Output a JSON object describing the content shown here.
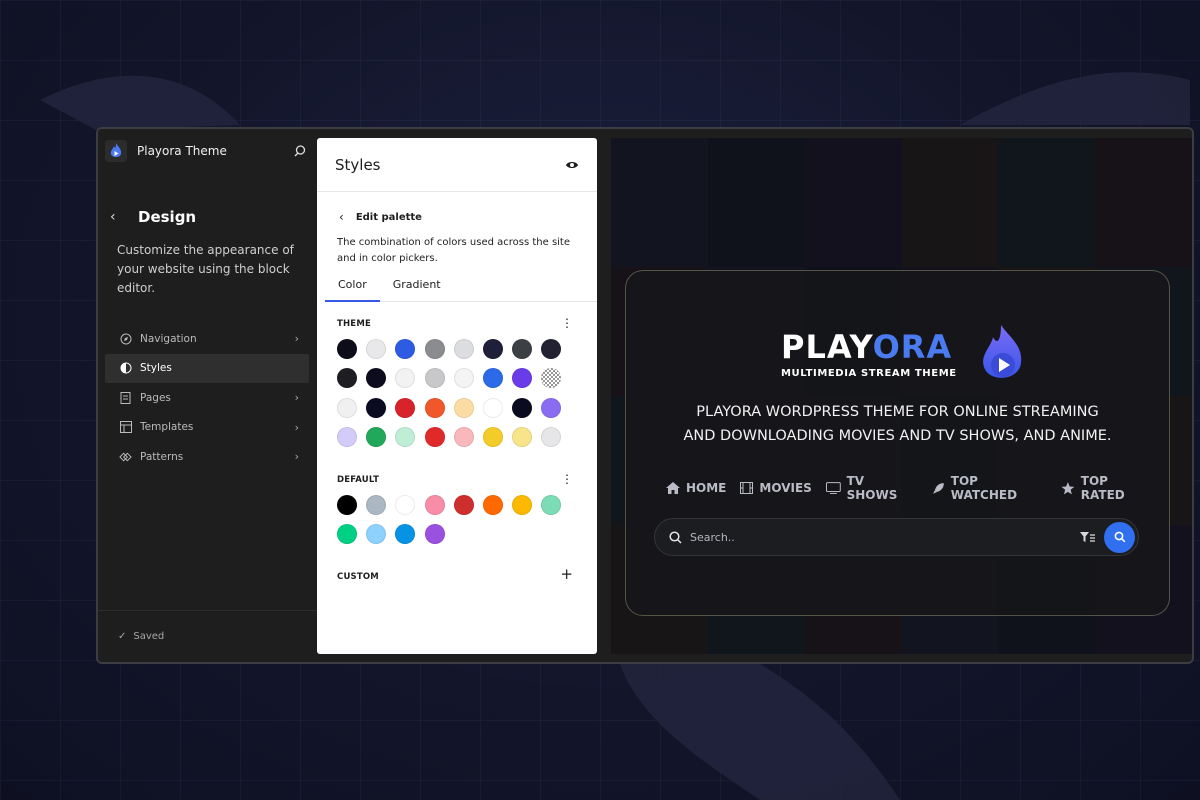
{
  "sidebar": {
    "site_title": "Playora Theme",
    "heading": "Design",
    "description": "Customize the appearance of your website using the block editor.",
    "items": [
      {
        "label": "Navigation",
        "icon": "compass-icon",
        "active": false
      },
      {
        "label": "Styles",
        "icon": "half-circle-icon",
        "active": true
      },
      {
        "label": "Pages",
        "icon": "page-icon",
        "active": false
      },
      {
        "label": "Templates",
        "icon": "layout-icon",
        "active": false
      },
      {
        "label": "Patterns",
        "icon": "diamond-icon",
        "active": false
      }
    ],
    "status": "Saved"
  },
  "styles_panel": {
    "title": "Styles",
    "subheading": "Edit palette",
    "description": "The combination of colors used across the site and in color pickers.",
    "tabs": [
      {
        "label": "Color",
        "active": true
      },
      {
        "label": "Gradient",
        "active": false
      }
    ],
    "theme_label": "THEME",
    "theme_colors": [
      "#0d0d1a",
      "#e8e8ea",
      "#2d5be3",
      "#8a8c90",
      "#dcdde0",
      "#1f1f3a",
      "#3c3f44",
      "#222233",
      "#1e1e22",
      "#0c0c1e",
      "#f2f2f3",
      "#c8c8ca",
      "#f4f4f5",
      "#2c6ae8",
      "#6a3ce8",
      "checker",
      "#f0f0f0",
      "#0b0b22",
      "#d8232a",
      "#f0582a",
      "#fbdca4",
      "#ffffff",
      "#0b0b20",
      "#8a6cf0",
      "#d4ccf8",
      "#22a85a",
      "#bfeed6",
      "#e02a2a",
      "#f8b8bc",
      "#f4cc2a",
      "#f8e48a",
      "#e6e6e8"
    ],
    "default_label": "DEFAULT",
    "default_colors": [
      "#000000",
      "#abb8c3",
      "#ffffff",
      "#f78da7",
      "#cf2e2e",
      "#ff6900",
      "#fcb900",
      "#7bdcb5",
      "#00d084",
      "#8ed1fc",
      "#0693e3",
      "#9b51e0"
    ],
    "custom_label": "CUSTOM"
  },
  "preview": {
    "logo_play": "PLAY",
    "logo_ora": "ORA",
    "logo_tagline": "MULTIMEDIA STREAM THEME",
    "headline_line1": "PLAYORA WORDPRESS THEME FOR ONLINE STREAMING",
    "headline_line2": "AND DOWNLOADING MOVIES AND TV SHOWS, AND ANIME.",
    "nav": [
      {
        "label": "HOME",
        "icon": "home-icon"
      },
      {
        "label": "MOVIES",
        "icon": "film-icon"
      },
      {
        "label": "TV SHOWS",
        "icon": "tv-icon"
      },
      {
        "label": "TOP WATCHED",
        "icon": "rocket-icon"
      },
      {
        "label": "TOP RATED",
        "icon": "star-icon"
      }
    ],
    "search_placeholder": "Search..",
    "accent": "#2f6ff0"
  }
}
